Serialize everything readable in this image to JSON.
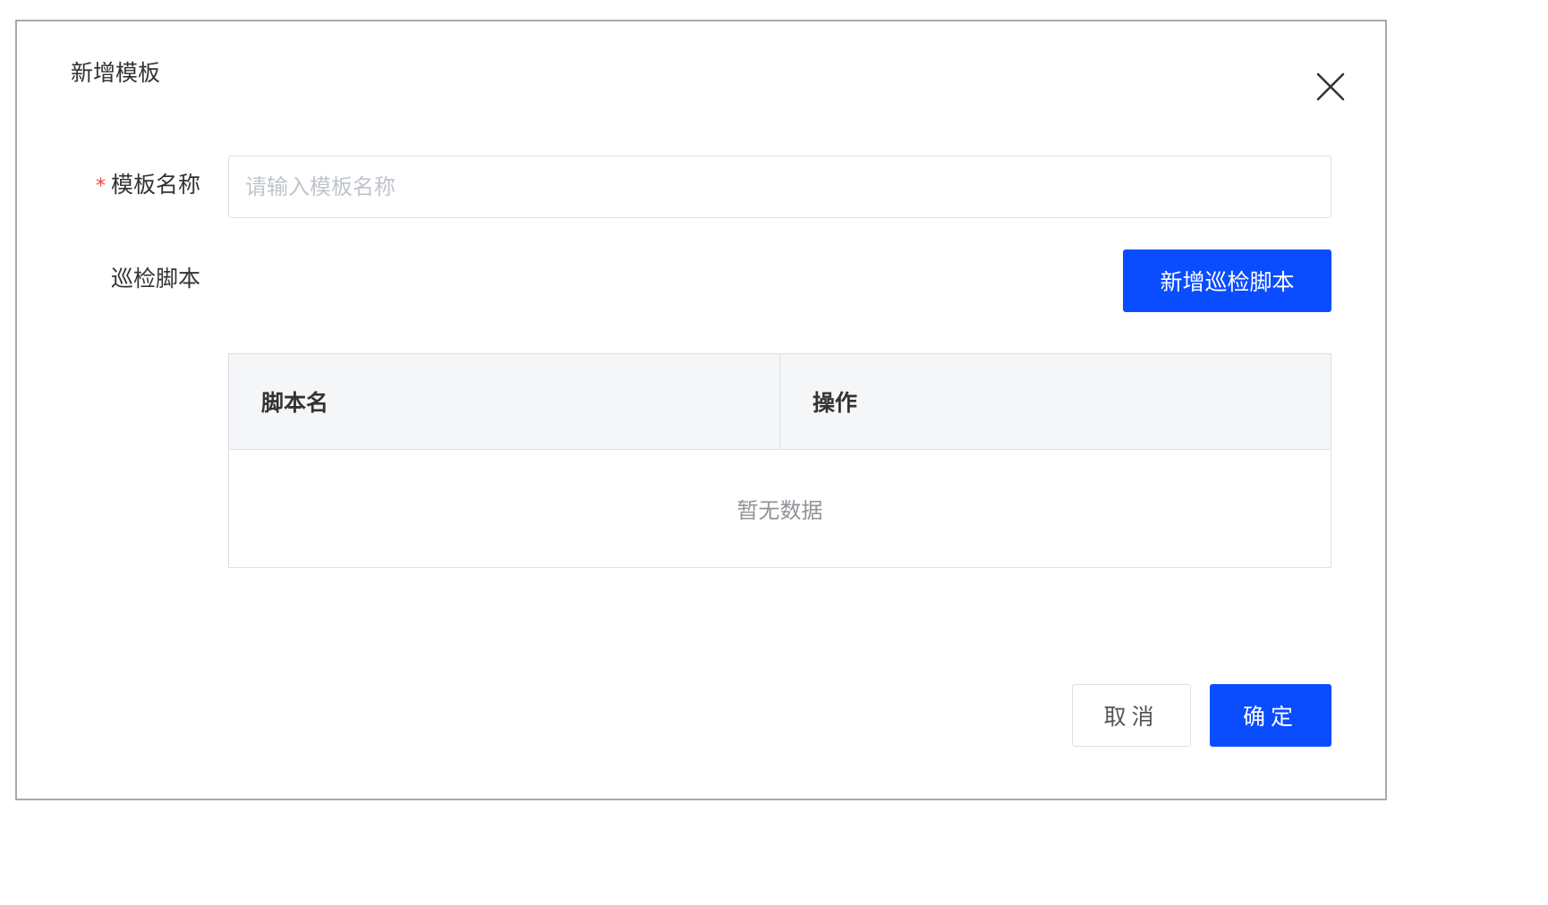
{
  "dialog": {
    "title": "新增模板",
    "close_icon": "close-icon"
  },
  "form": {
    "name_label": "模板名称",
    "name_required_mark": "*",
    "name_placeholder": "请输入模板名称",
    "name_value": "",
    "script_label": "巡检脚本",
    "add_script_button": "新增巡检脚本"
  },
  "table": {
    "columns": [
      "脚本名",
      "操作"
    ],
    "rows": [],
    "empty_text": "暂无数据"
  },
  "footer": {
    "cancel_label": "取消",
    "confirm_label": "确定"
  },
  "colors": {
    "primary": "#0a4dff",
    "required": "#e8453c",
    "border": "#dcdfe6",
    "table_header_bg": "#f5f6f8"
  }
}
